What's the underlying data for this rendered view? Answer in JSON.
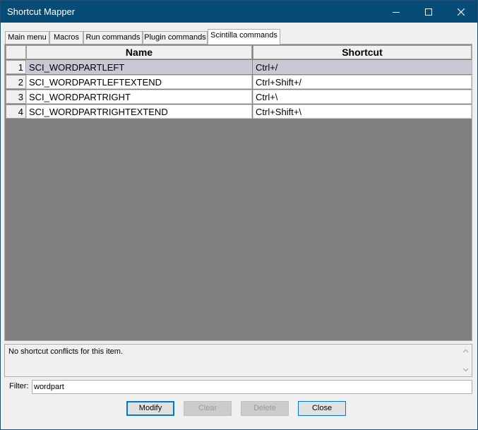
{
  "window": {
    "title": "Shortcut Mapper"
  },
  "tabs": [
    {
      "label": "Main menu",
      "active": false
    },
    {
      "label": "Macros",
      "active": false
    },
    {
      "label": "Run commands",
      "active": false
    },
    {
      "label": "Plugin commands",
      "active": false
    },
    {
      "label": "Scintilla commands",
      "active": true
    }
  ],
  "grid": {
    "columns": [
      "Name",
      "Shortcut"
    ],
    "rows": [
      {
        "num": "1",
        "name": "SCI_WORDPARTLEFT",
        "shortcut": "Ctrl+/"
      },
      {
        "num": "2",
        "name": "SCI_WORDPARTLEFTEXTEND",
        "shortcut": "Ctrl+Shift+/"
      },
      {
        "num": "3",
        "name": "SCI_WORDPARTRIGHT",
        "shortcut": "Ctrl+\\"
      },
      {
        "num": "4",
        "name": "SCI_WORDPARTRIGHTEXTEND",
        "shortcut": "Ctrl+Shift+\\"
      }
    ]
  },
  "conflicts": {
    "text": "No shortcut conflicts for this item."
  },
  "filter": {
    "label": "Filter:",
    "value": "wordpart"
  },
  "buttons": {
    "modify": "Modify",
    "clear": "Clear",
    "delete": "Delete",
    "close": "Close"
  },
  "colors": {
    "titlebar": "#074c76",
    "selected_row": "#c8c8d4",
    "grid_background": "#808080",
    "default_button_border": "#0078d7"
  }
}
